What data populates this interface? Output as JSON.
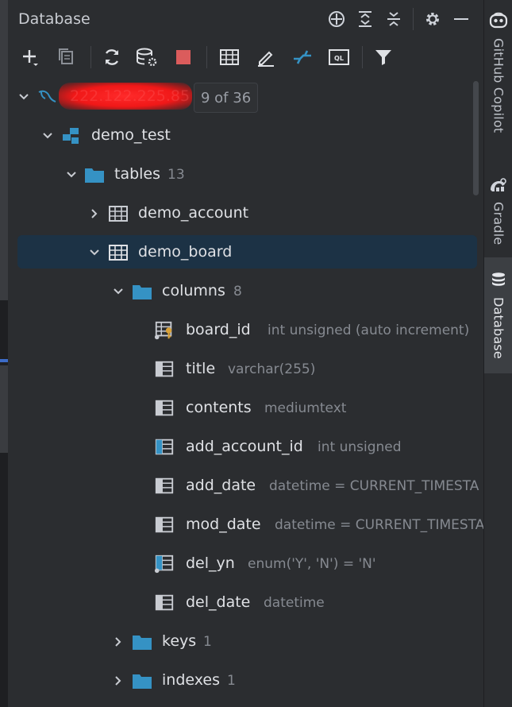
{
  "header": {
    "title": "Database"
  },
  "header_icons": [
    "crosshair-icon",
    "expand-all-icon",
    "collapse-all-icon",
    "gear-icon",
    "minimize-icon"
  ],
  "toolbar": [
    "add-icon",
    "duplicate-icon",
    "refresh-icon",
    "schema-settings-icon",
    "stop-icon",
    "table-view-icon",
    "edit-icon",
    "jump-to-icon",
    "query-console-icon",
    "filter-icon"
  ],
  "colors": {
    "accent_blue": "#3592c4",
    "selection": "#1c3245",
    "key_gold": "#d9a23a",
    "stop_red": "#db5c5c"
  },
  "tree": {
    "connection": {
      "name": "222.122.225.85",
      "badge": "9 of 36"
    },
    "schema": {
      "name": "demo_test"
    },
    "tables": {
      "label": "tables",
      "count": "13"
    },
    "table1": {
      "name": "demo_account"
    },
    "table2": {
      "name": "demo_board"
    },
    "columns": {
      "label": "columns",
      "count": "8"
    },
    "cols": [
      {
        "name": "board_id",
        "type": "int unsigned (auto increment)"
      },
      {
        "name": "title",
        "type": "varchar(255)"
      },
      {
        "name": "contents",
        "type": "mediumtext"
      },
      {
        "name": "add_account_id",
        "type": "int unsigned"
      },
      {
        "name": "add_date",
        "type": "datetime  =  CURRENT_TIMESTA"
      },
      {
        "name": "mod_date",
        "type": "datetime  =  CURRENT_TIMESTA"
      },
      {
        "name": "del_yn",
        "type": "enum('Y', 'N')  =  'N'"
      },
      {
        "name": "del_date",
        "type": "datetime"
      }
    ],
    "keys": {
      "label": "keys",
      "count": "1"
    },
    "indexes": {
      "label": "indexes",
      "count": "1"
    }
  },
  "side_tabs": [
    {
      "label": "GitHub Copilot",
      "icon": "copilot-icon"
    },
    {
      "label": "Gradle",
      "icon": "gradle-icon"
    },
    {
      "label": "Database",
      "icon": "database-icon"
    }
  ]
}
